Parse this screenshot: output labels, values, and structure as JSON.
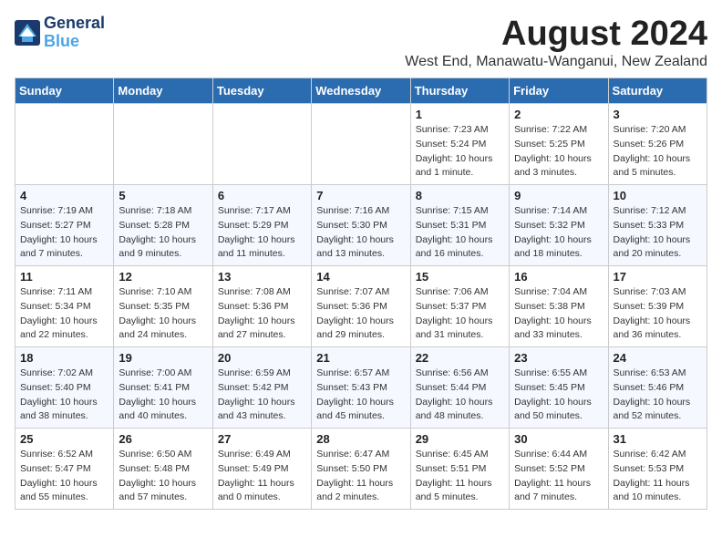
{
  "header": {
    "logo_line1": "General",
    "logo_line2": "Blue",
    "month": "August 2024",
    "location": "West End, Manawatu-Wanganui, New Zealand"
  },
  "weekdays": [
    "Sunday",
    "Monday",
    "Tuesday",
    "Wednesday",
    "Thursday",
    "Friday",
    "Saturday"
  ],
  "weeks": [
    [
      {
        "day": "",
        "sunrise": "",
        "sunset": "",
        "daylight": ""
      },
      {
        "day": "",
        "sunrise": "",
        "sunset": "",
        "daylight": ""
      },
      {
        "day": "",
        "sunrise": "",
        "sunset": "",
        "daylight": ""
      },
      {
        "day": "",
        "sunrise": "",
        "sunset": "",
        "daylight": ""
      },
      {
        "day": "1",
        "sunrise": "Sunrise: 7:23 AM",
        "sunset": "Sunset: 5:24 PM",
        "daylight": "Daylight: 10 hours and 1 minute."
      },
      {
        "day": "2",
        "sunrise": "Sunrise: 7:22 AM",
        "sunset": "Sunset: 5:25 PM",
        "daylight": "Daylight: 10 hours and 3 minutes."
      },
      {
        "day": "3",
        "sunrise": "Sunrise: 7:20 AM",
        "sunset": "Sunset: 5:26 PM",
        "daylight": "Daylight: 10 hours and 5 minutes."
      }
    ],
    [
      {
        "day": "4",
        "sunrise": "Sunrise: 7:19 AM",
        "sunset": "Sunset: 5:27 PM",
        "daylight": "Daylight: 10 hours and 7 minutes."
      },
      {
        "day": "5",
        "sunrise": "Sunrise: 7:18 AM",
        "sunset": "Sunset: 5:28 PM",
        "daylight": "Daylight: 10 hours and 9 minutes."
      },
      {
        "day": "6",
        "sunrise": "Sunrise: 7:17 AM",
        "sunset": "Sunset: 5:29 PM",
        "daylight": "Daylight: 10 hours and 11 minutes."
      },
      {
        "day": "7",
        "sunrise": "Sunrise: 7:16 AM",
        "sunset": "Sunset: 5:30 PM",
        "daylight": "Daylight: 10 hours and 13 minutes."
      },
      {
        "day": "8",
        "sunrise": "Sunrise: 7:15 AM",
        "sunset": "Sunset: 5:31 PM",
        "daylight": "Daylight: 10 hours and 16 minutes."
      },
      {
        "day": "9",
        "sunrise": "Sunrise: 7:14 AM",
        "sunset": "Sunset: 5:32 PM",
        "daylight": "Daylight: 10 hours and 18 minutes."
      },
      {
        "day": "10",
        "sunrise": "Sunrise: 7:12 AM",
        "sunset": "Sunset: 5:33 PM",
        "daylight": "Daylight: 10 hours and 20 minutes."
      }
    ],
    [
      {
        "day": "11",
        "sunrise": "Sunrise: 7:11 AM",
        "sunset": "Sunset: 5:34 PM",
        "daylight": "Daylight: 10 hours and 22 minutes."
      },
      {
        "day": "12",
        "sunrise": "Sunrise: 7:10 AM",
        "sunset": "Sunset: 5:35 PM",
        "daylight": "Daylight: 10 hours and 24 minutes."
      },
      {
        "day": "13",
        "sunrise": "Sunrise: 7:08 AM",
        "sunset": "Sunset: 5:36 PM",
        "daylight": "Daylight: 10 hours and 27 minutes."
      },
      {
        "day": "14",
        "sunrise": "Sunrise: 7:07 AM",
        "sunset": "Sunset: 5:36 PM",
        "daylight": "Daylight: 10 hours and 29 minutes."
      },
      {
        "day": "15",
        "sunrise": "Sunrise: 7:06 AM",
        "sunset": "Sunset: 5:37 PM",
        "daylight": "Daylight: 10 hours and 31 minutes."
      },
      {
        "day": "16",
        "sunrise": "Sunrise: 7:04 AM",
        "sunset": "Sunset: 5:38 PM",
        "daylight": "Daylight: 10 hours and 33 minutes."
      },
      {
        "day": "17",
        "sunrise": "Sunrise: 7:03 AM",
        "sunset": "Sunset: 5:39 PM",
        "daylight": "Daylight: 10 hours and 36 minutes."
      }
    ],
    [
      {
        "day": "18",
        "sunrise": "Sunrise: 7:02 AM",
        "sunset": "Sunset: 5:40 PM",
        "daylight": "Daylight: 10 hours and 38 minutes."
      },
      {
        "day": "19",
        "sunrise": "Sunrise: 7:00 AM",
        "sunset": "Sunset: 5:41 PM",
        "daylight": "Daylight: 10 hours and 40 minutes."
      },
      {
        "day": "20",
        "sunrise": "Sunrise: 6:59 AM",
        "sunset": "Sunset: 5:42 PM",
        "daylight": "Daylight: 10 hours and 43 minutes."
      },
      {
        "day": "21",
        "sunrise": "Sunrise: 6:57 AM",
        "sunset": "Sunset: 5:43 PM",
        "daylight": "Daylight: 10 hours and 45 minutes."
      },
      {
        "day": "22",
        "sunrise": "Sunrise: 6:56 AM",
        "sunset": "Sunset: 5:44 PM",
        "daylight": "Daylight: 10 hours and 48 minutes."
      },
      {
        "day": "23",
        "sunrise": "Sunrise: 6:55 AM",
        "sunset": "Sunset: 5:45 PM",
        "daylight": "Daylight: 10 hours and 50 minutes."
      },
      {
        "day": "24",
        "sunrise": "Sunrise: 6:53 AM",
        "sunset": "Sunset: 5:46 PM",
        "daylight": "Daylight: 10 hours and 52 minutes."
      }
    ],
    [
      {
        "day": "25",
        "sunrise": "Sunrise: 6:52 AM",
        "sunset": "Sunset: 5:47 PM",
        "daylight": "Daylight: 10 hours and 55 minutes."
      },
      {
        "day": "26",
        "sunrise": "Sunrise: 6:50 AM",
        "sunset": "Sunset: 5:48 PM",
        "daylight": "Daylight: 10 hours and 57 minutes."
      },
      {
        "day": "27",
        "sunrise": "Sunrise: 6:49 AM",
        "sunset": "Sunset: 5:49 PM",
        "daylight": "Daylight: 11 hours and 0 minutes."
      },
      {
        "day": "28",
        "sunrise": "Sunrise: 6:47 AM",
        "sunset": "Sunset: 5:50 PM",
        "daylight": "Daylight: 11 hours and 2 minutes."
      },
      {
        "day": "29",
        "sunrise": "Sunrise: 6:45 AM",
        "sunset": "Sunset: 5:51 PM",
        "daylight": "Daylight: 11 hours and 5 minutes."
      },
      {
        "day": "30",
        "sunrise": "Sunrise: 6:44 AM",
        "sunset": "Sunset: 5:52 PM",
        "daylight": "Daylight: 11 hours and 7 minutes."
      },
      {
        "day": "31",
        "sunrise": "Sunrise: 6:42 AM",
        "sunset": "Sunset: 5:53 PM",
        "daylight": "Daylight: 11 hours and 10 minutes."
      }
    ]
  ]
}
